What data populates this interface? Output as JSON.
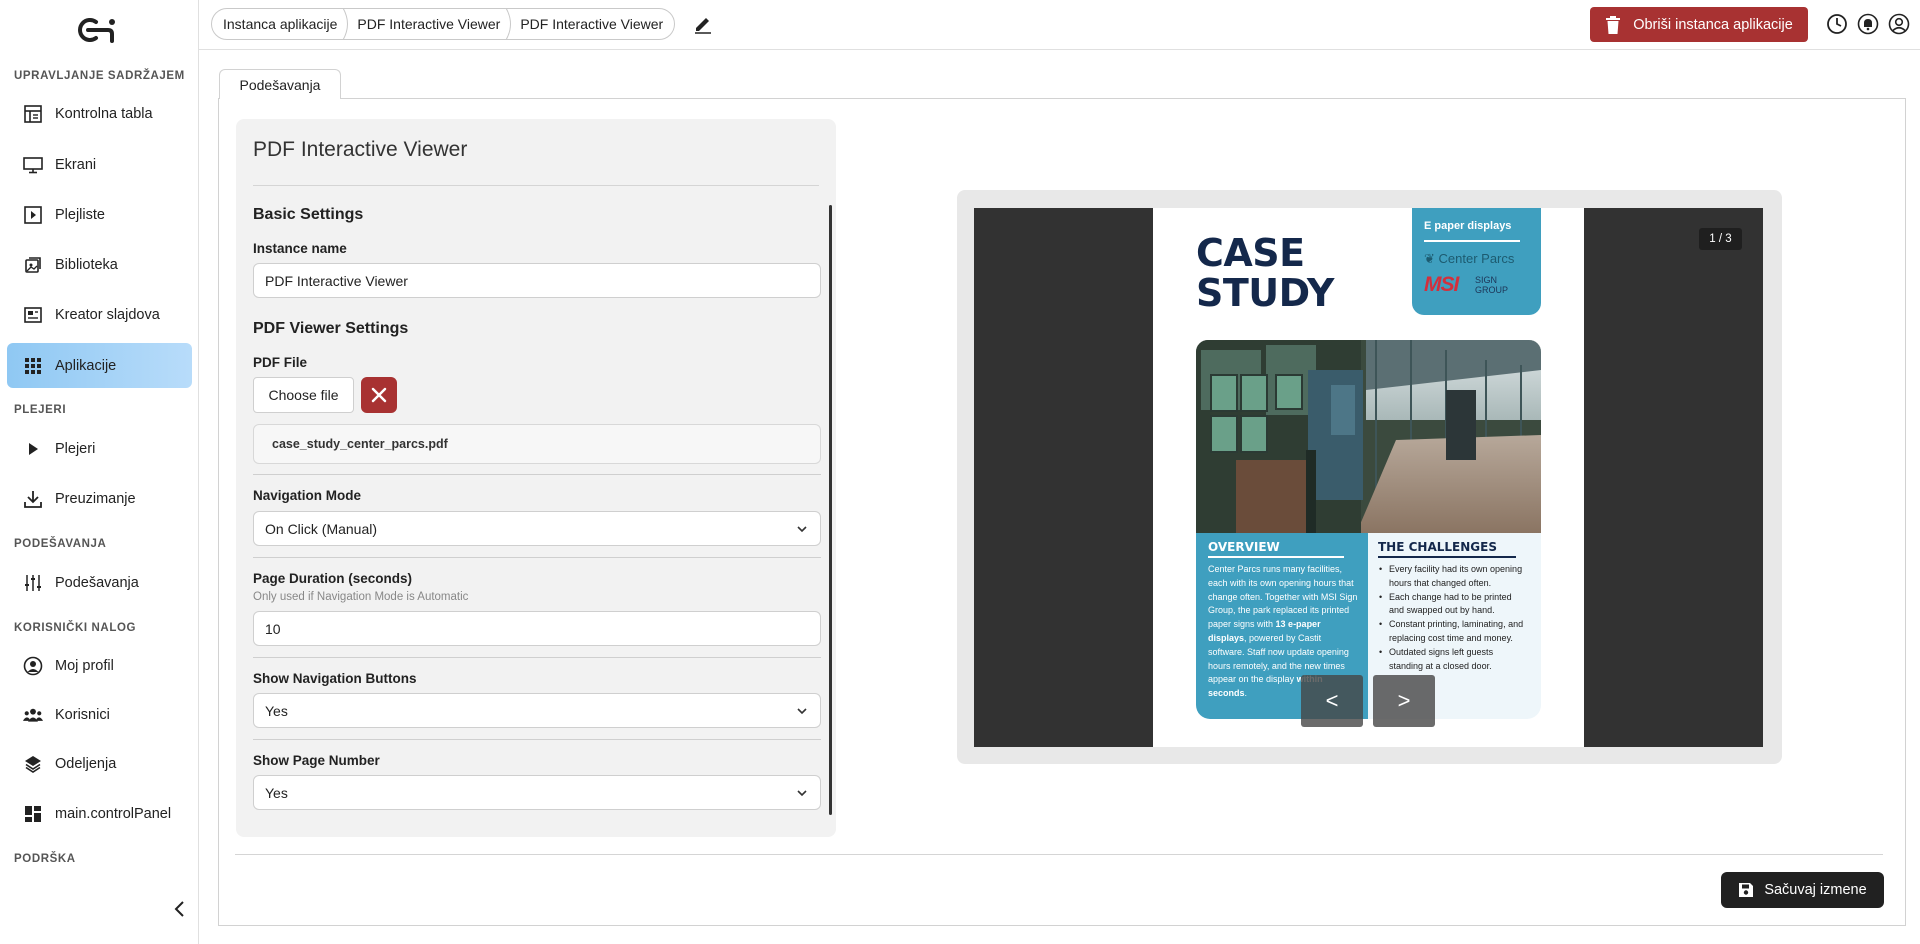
{
  "sidebar": {
    "logo_text": "ci",
    "sections": [
      {
        "title": "UPRAVLJANJE SADRŽAJEM"
      },
      {
        "title": "PLEJERI"
      },
      {
        "title": "PODEŠAVANJA"
      },
      {
        "title": "KORISNIČKI NALOG"
      },
      {
        "title": "PODRŠKA"
      }
    ],
    "items": [
      {
        "label": "Kontrolna tabla",
        "icon": "dashboard-icon"
      },
      {
        "label": "Ekrani",
        "icon": "monitor-icon"
      },
      {
        "label": "Plejliste",
        "icon": "playlist-icon"
      },
      {
        "label": "Biblioteka",
        "icon": "library-icon"
      },
      {
        "label": "Kreator slajdova",
        "icon": "slide-creator-icon"
      },
      {
        "label": "Aplikacije",
        "icon": "apps-grid-icon",
        "active": true
      },
      {
        "label": "Plejeri",
        "icon": "play-icon"
      },
      {
        "label": "Preuzimanje",
        "icon": "download-icon"
      },
      {
        "label": "Podešavanja",
        "icon": "sliders-icon"
      },
      {
        "label": "Moj profil",
        "icon": "user-circle-icon"
      },
      {
        "label": "Korisnici",
        "icon": "users-icon"
      },
      {
        "label": "Odeljenja",
        "icon": "layers-icon"
      },
      {
        "label": "main.controlPanel",
        "icon": "control-panel-icon"
      }
    ]
  },
  "topbar": {
    "breadcrumb": [
      "Instanca aplikacije",
      "PDF Interactive Viewer",
      "PDF Interactive Viewer"
    ],
    "delete_label": "Obriši instanca aplikacije"
  },
  "tab_label": "Podešavanja",
  "form": {
    "title": "PDF Interactive Viewer",
    "basic_heading": "Basic Settings",
    "instance_name_label": "Instance name",
    "instance_name_value": "PDF Interactive Viewer",
    "pdf_heading": "PDF Viewer Settings",
    "pdf_file_label": "PDF File",
    "choose_file_label": "Choose file",
    "file_name": "case_study_center_parcs.pdf",
    "nav_mode_label": "Navigation Mode",
    "nav_mode_value": "On Click (Manual)",
    "duration_label": "Page Duration (seconds)",
    "duration_hint": "Only used if Navigation Mode is Automatic",
    "duration_value": "10",
    "show_nav_label": "Show Navigation Buttons",
    "show_nav_value": "Yes",
    "show_page_label": "Show Page Number",
    "show_page_value": "Yes"
  },
  "preview": {
    "page_number": "1 / 3",
    "prev_label": "<",
    "next_label": ">",
    "pdf": {
      "title_line1": "CASE",
      "title_line2": "STUDY",
      "brand_top": "E paper displays",
      "brand_center_parcs": "Center Parcs",
      "brand_msi": "MSI",
      "brand_sign_line1": "SIGN",
      "brand_sign_line2": "GROUP",
      "overview_heading": "OVERVIEW",
      "overview_text_1": "Center Parcs runs many facilities, each with its own opening hours that change often. Together with MSI Sign Group, the park replaced its printed paper signs with ",
      "overview_bold_1": "13 e-paper displays",
      "overview_text_2": ", powered by Castit software. Staff now update opening hours remotely, and the new times appear on the display ",
      "overview_bold_2": "within seconds",
      "overview_text_3": ".",
      "challenges_heading": "THE CHALLENGES",
      "challenges": [
        "Every facility had its own opening hours that changed often.",
        "Each change had to be printed and swapped out by hand.",
        "Constant printing, laminating, and replacing cost time and money.",
        "Outdated signs left guests standing at a closed door."
      ]
    }
  },
  "footer": {
    "save_label": "Sačuvaj izmene"
  },
  "colors": {
    "danger": "#a83232",
    "active_nav": "#8fc8f3",
    "pdf_accent": "#3f9fbf",
    "pdf_navy": "#14284b"
  }
}
